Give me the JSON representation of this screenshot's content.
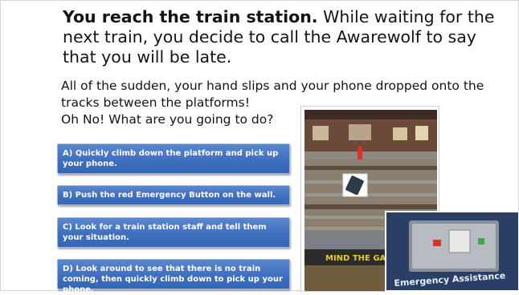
{
  "headline": {
    "bold": "You reach the train station.",
    "rest": " While waiting for the next train, you decide to call the Awarewolf to say that you will be late."
  },
  "body": {
    "line1": "All of the sudden, your hand slips and your phone dropped onto the tracks between the platforms!",
    "line2": "Oh No! What are you going to do?"
  },
  "options": [
    {
      "label": "A) Quickly climb down the platform and pick up your phone."
    },
    {
      "label": "B) Push the red Emergency Button on the wall."
    },
    {
      "label": "C) Look for a train station staff and tell them your situation."
    },
    {
      "label": "D) Look around to see that there is no train coming, then quickly climb down to pick up your phone."
    }
  ],
  "photo": {
    "platform_sign": "MIND THE GAP"
  },
  "inset": {
    "panel_label": "Emergency Assistance"
  },
  "colors": {
    "option_blue": "#3f6fbf",
    "emergency_red": "#d8322a",
    "emergency_green": "#39a84a"
  }
}
